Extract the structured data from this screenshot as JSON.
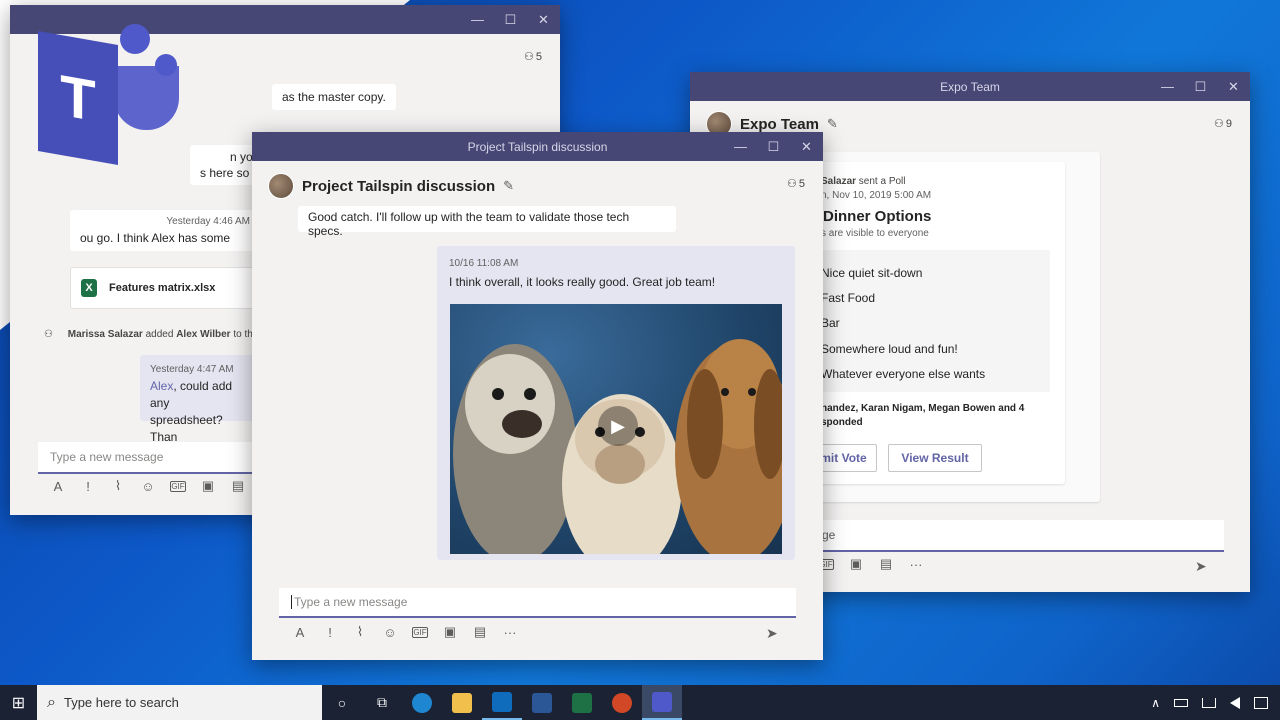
{
  "back_window": {
    "member_count": "5",
    "msg_master_copy": "as the master copy.",
    "msg_partial_1": "n you ple",
    "msg_partial_2": "s here so we",
    "msg_time": "Yesterday 4:46 AM",
    "msg_text": "ou go.  I think Alex has some",
    "file_name": "Features matrix.xlsx",
    "file_icon_letter": "X",
    "event_actor": "Marissa Salazar",
    "event_verb": " added ",
    "event_target": "Alex Wilber",
    "event_tail": " to th",
    "reply_time": "Yesterday 4:47 AM",
    "reply_mention": "Alex",
    "reply_text": ", could add any",
    "reply_text_2": "spreadsheet?  Than",
    "compose_placeholder": "Type a new message"
  },
  "expo_window": {
    "window_title": "Expo Team",
    "chat_title": "Expo Team",
    "member_count": "9",
    "poll_sender": "Salazar",
    "poll_sender_suffix": " sent a Poll",
    "poll_date": "n, Nov 10, 2019 5:00 AM",
    "poll_title": "Dinner Options",
    "poll_visibility": "s are visible to everyone",
    "options": [
      "Nice quiet sit-down",
      "Fast Food",
      "Bar",
      "Somewhere loud and fun!",
      "Whatever everyone else wants"
    ],
    "responders": "nandez, Karan Nigam, Megan Bowen and 4",
    "responders_2": "sponded",
    "submit_label": "mit Vote",
    "view_result_label": "View Result",
    "compose_placeholder": "ge"
  },
  "main_window": {
    "window_title": "Project Tailspin discussion",
    "chat_title": "Project Tailspin discussion",
    "member_count": "5",
    "incoming_text": "Good catch.  I'll follow up with the team to validate those tech specs.",
    "my_msg_time": "10/16 11:08 AM",
    "my_msg_text": "I think overall, it looks really good.  Great job team!",
    "compose_placeholder": "Type a new message"
  },
  "taskbar": {
    "search_placeholder": "Type here to search"
  },
  "logo": {
    "letter": "T",
    "color": "#5059c9"
  },
  "icons": {
    "minimize": "—",
    "maximize": "☐",
    "close": "✕",
    "format": "A",
    "important": "!",
    "attach": "⌇",
    "emoji": "☺",
    "gif": "GIF",
    "sticker": "▣",
    "praise": "▤",
    "more": "···",
    "send": "➤",
    "pencil": "✎",
    "people": "⚇",
    "play": "▶",
    "windows": "⊞",
    "search": "⌕",
    "cortana": "○",
    "taskview": "⧉",
    "chevron_up": "∧"
  }
}
